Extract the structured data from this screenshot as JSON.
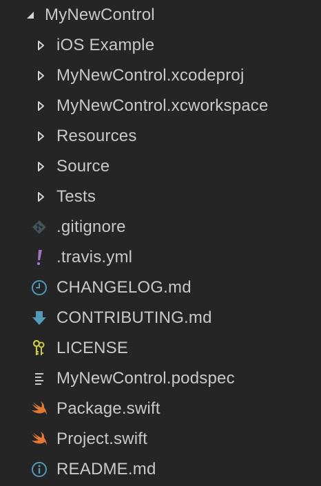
{
  "explorer": {
    "root": {
      "label": "MyNewControl",
      "icon": "chevron-expanded-icon",
      "expanded": true
    },
    "folders": [
      {
        "label": "iOS Example",
        "icon": "chevron-collapsed-icon"
      },
      {
        "label": "MyNewControl.xcodeproj",
        "icon": "chevron-collapsed-icon"
      },
      {
        "label": "MyNewControl.xcworkspace",
        "icon": "chevron-collapsed-icon"
      },
      {
        "label": "Resources",
        "icon": "chevron-collapsed-icon"
      },
      {
        "label": "Source",
        "icon": "chevron-collapsed-icon"
      },
      {
        "label": "Tests",
        "icon": "chevron-collapsed-icon"
      }
    ],
    "files": [
      {
        "label": ".gitignore",
        "icon": "git-icon"
      },
      {
        "label": ".travis.yml",
        "icon": "exclamation-icon"
      },
      {
        "label": "CHANGELOG.md",
        "icon": "clock-icon"
      },
      {
        "label": "CONTRIBUTING.md",
        "icon": "download-arrow-icon"
      },
      {
        "label": "LICENSE",
        "icon": "key-icon"
      },
      {
        "label": "MyNewControl.podspec",
        "icon": "text-lines-icon"
      },
      {
        "label": "Package.swift",
        "icon": "swift-icon"
      },
      {
        "label": "Project.swift",
        "icon": "swift-icon"
      },
      {
        "label": "README.md",
        "icon": "info-icon"
      }
    ]
  },
  "colors": {
    "background": "#252526",
    "text": "#c9c9c9",
    "twisty": "#d4d4d4",
    "git": "#41535b",
    "travis": "#a074c4",
    "changelog": "#519aba",
    "contributing": "#519aba",
    "license": "#cbcb41",
    "swift": "#e37933",
    "info": "#519aba"
  }
}
